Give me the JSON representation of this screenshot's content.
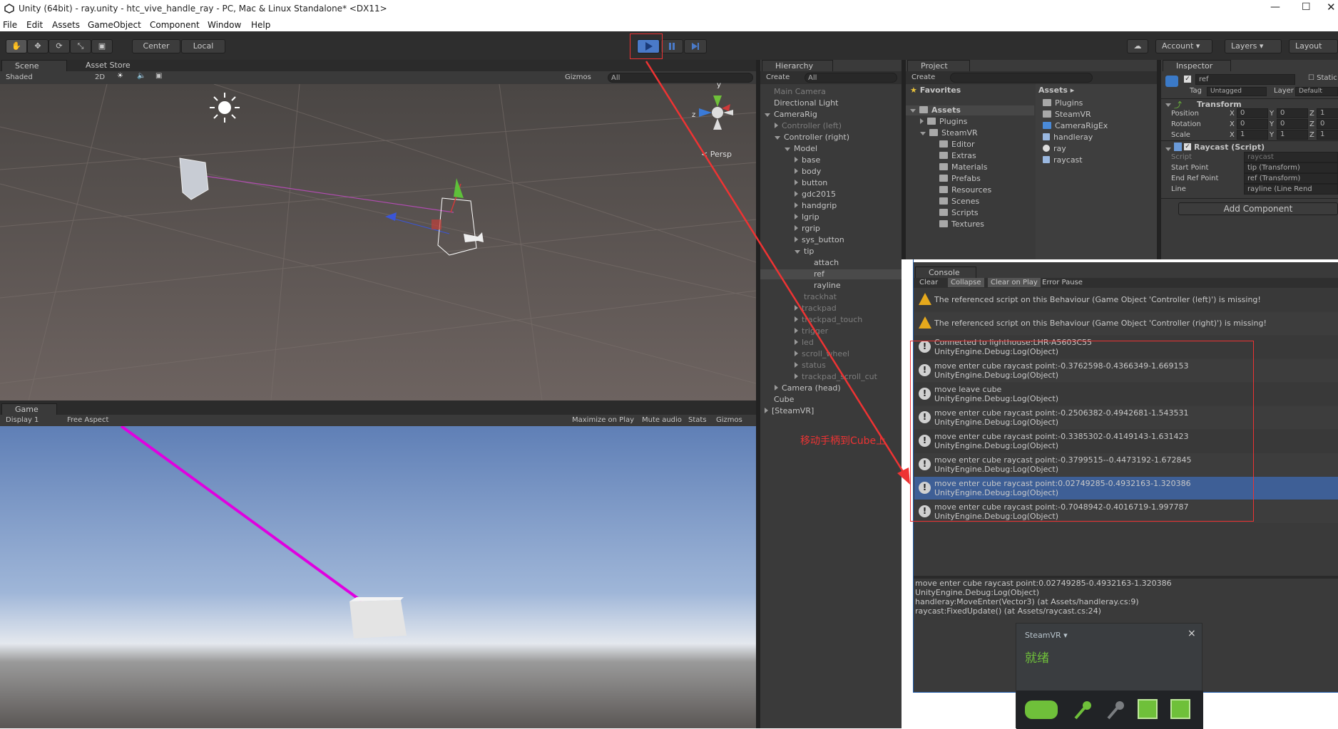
{
  "window": {
    "title": "Unity (64bit) - ray.unity - htc_vive_handle_ray - PC, Mac & Linux Standalone* <DX11>"
  },
  "menu": [
    "File",
    "Edit",
    "Assets",
    "GameObject",
    "Component",
    "Window",
    "Help"
  ],
  "toolbar": {
    "center": "Center",
    "local": "Local",
    "account": "Account",
    "layers": "Layers",
    "layout": "Layout"
  },
  "scene": {
    "tab": "Scene",
    "asset_store": "Asset Store",
    "shading": "Shaded",
    "mode_2d": "2D",
    "gizmos": "Gizmos",
    "search": "All",
    "persp": "< Persp",
    "gizmo_y": "y",
    "gizmo_z": "z"
  },
  "game": {
    "tab": "Game",
    "display": "Display 1",
    "aspect": "Free Aspect",
    "maximize": "Maximize on Play",
    "mute": "Mute audio",
    "stats": "Stats",
    "gizmos": "Gizmos"
  },
  "hierarchy": {
    "tab": "Hierarchy",
    "create": "Create",
    "search": "All",
    "items": [
      {
        "label": "Main Camera",
        "indent": 0,
        "dim": true,
        "arrow": ""
      },
      {
        "label": "Directional Light",
        "indent": 0,
        "dim": false,
        "arrow": ""
      },
      {
        "label": "CameraRig",
        "indent": 0,
        "dim": false,
        "arrow": "down"
      },
      {
        "label": "Controller (left)",
        "indent": 1,
        "dim": true,
        "arrow": "right"
      },
      {
        "label": "Controller (right)",
        "indent": 1,
        "dim": false,
        "arrow": "down"
      },
      {
        "label": "Model",
        "indent": 2,
        "dim": false,
        "arrow": "down"
      },
      {
        "label": "base",
        "indent": 3,
        "dim": false,
        "arrow": "right"
      },
      {
        "label": "body",
        "indent": 3,
        "dim": false,
        "arrow": "right"
      },
      {
        "label": "button",
        "indent": 3,
        "dim": false,
        "arrow": "right"
      },
      {
        "label": "gdc2015",
        "indent": 3,
        "dim": false,
        "arrow": "right"
      },
      {
        "label": "handgrip",
        "indent": 3,
        "dim": false,
        "arrow": "right"
      },
      {
        "label": "lgrip",
        "indent": 3,
        "dim": false,
        "arrow": "right"
      },
      {
        "label": "rgrip",
        "indent": 3,
        "dim": false,
        "arrow": "right"
      },
      {
        "label": "sys_button",
        "indent": 3,
        "dim": false,
        "arrow": "right"
      },
      {
        "label": "tip",
        "indent": 3,
        "dim": false,
        "arrow": "down"
      },
      {
        "label": "attach",
        "indent": 4,
        "dim": false,
        "arrow": ""
      },
      {
        "label": "ref",
        "indent": 4,
        "dim": false,
        "arrow": "",
        "selected": true
      },
      {
        "label": "rayline",
        "indent": 4,
        "dim": false,
        "arrow": ""
      },
      {
        "label": "trackhat",
        "indent": 3,
        "dim": true,
        "arrow": ""
      },
      {
        "label": "trackpad",
        "indent": 3,
        "dim": true,
        "arrow": "right"
      },
      {
        "label": "trackpad_touch",
        "indent": 3,
        "dim": true,
        "arrow": "right"
      },
      {
        "label": "trigger",
        "indent": 3,
        "dim": true,
        "arrow": "right"
      },
      {
        "label": "led",
        "indent": 3,
        "dim": true,
        "arrow": "right"
      },
      {
        "label": "scroll_wheel",
        "indent": 3,
        "dim": true,
        "arrow": "right"
      },
      {
        "label": "status",
        "indent": 3,
        "dim": true,
        "arrow": "right"
      },
      {
        "label": "trackpad_scroll_cut",
        "indent": 3,
        "dim": true,
        "arrow": "right"
      },
      {
        "label": "Camera (head)",
        "indent": 1,
        "dim": false,
        "arrow": "right"
      },
      {
        "label": "Cube",
        "indent": 0,
        "dim": false,
        "arrow": ""
      },
      {
        "label": "[SteamVR]",
        "indent": 0,
        "dim": false,
        "arrow": "right"
      }
    ]
  },
  "annotation": "移动手柄到Cube上",
  "project": {
    "tab": "Project",
    "create": "Create",
    "favorites": "Favorites",
    "assets_root": "Assets",
    "tree": [
      {
        "label": "Plugins",
        "indent": 1
      },
      {
        "label": "SteamVR",
        "indent": 1,
        "open": true
      },
      {
        "label": "Editor",
        "indent": 2
      },
      {
        "label": "Extras",
        "indent": 2
      },
      {
        "label": "Materials",
        "indent": 2
      },
      {
        "label": "Prefabs",
        "indent": 2
      },
      {
        "label": "Resources",
        "indent": 2
      },
      {
        "label": "Scenes",
        "indent": 2
      },
      {
        "label": "Scripts",
        "indent": 2
      },
      {
        "label": "Textures",
        "indent": 2
      }
    ],
    "assets_header": "Assets ▸",
    "assets": [
      {
        "label": "Plugins",
        "icon": "folder-icon"
      },
      {
        "label": "SteamVR",
        "icon": "folder-icon"
      },
      {
        "label": "CameraRigEx",
        "icon": "prefab-icon"
      },
      {
        "label": "handleray",
        "icon": "script-icon"
      },
      {
        "label": "ray",
        "icon": "unity-scene-icon"
      },
      {
        "label": "raycast",
        "icon": "script-icon"
      }
    ]
  },
  "inspector": {
    "tab": "Inspector",
    "name": "ref",
    "static": "Static",
    "tag_label": "Tag",
    "tag": "Untagged",
    "layer_label": "Layer",
    "layer": "Default",
    "transform": {
      "title": "Transform",
      "position": {
        "label": "Position",
        "x": "0",
        "y": "0",
        "z": "1"
      },
      "rotation": {
        "label": "Rotation",
        "x": "0",
        "y": "0",
        "z": "0"
      },
      "scale": {
        "label": "Scale",
        "x": "1",
        "y": "1",
        "z": "1"
      }
    },
    "raycast": {
      "title": "Raycast (Script)",
      "script_label": "Script",
      "script": "raycast",
      "start_label": "Start Point",
      "start": "tip (Transform)",
      "end_label": "End Ref Point",
      "end": "ref (Transform)",
      "line_label": "Line",
      "line": "rayline (Line Rend"
    },
    "add_component": "Add Component"
  },
  "console": {
    "tab": "Console",
    "buttons": [
      "Clear",
      "Collapse",
      "Clear on Play",
      "Error Pause"
    ],
    "entries": [
      {
        "type": "warning",
        "line1": "The referenced script on this Behaviour (Game Object 'Controller (left)') is missing!",
        "line2": ""
      },
      {
        "type": "warning",
        "line1": "The referenced script on this Behaviour (Game Object 'Controller (right)') is missing!",
        "line2": ""
      },
      {
        "type": "info",
        "line1": "Connected to lighthouse:LHR-A5603C55",
        "line2": "UnityEngine.Debug:Log(Object)"
      },
      {
        "type": "info",
        "line1": "move enter cube raycast point:-0.3762598-0.4366349-1.669153",
        "line2": "UnityEngine.Debug:Log(Object)"
      },
      {
        "type": "info",
        "line1": "move leave cube",
        "line2": "UnityEngine.Debug:Log(Object)"
      },
      {
        "type": "info",
        "line1": "move enter cube raycast point:-0.2506382-0.4942681-1.543531",
        "line2": "UnityEngine.Debug:Log(Object)"
      },
      {
        "type": "info",
        "line1": "move enter cube raycast point:-0.3385302-0.4149143-1.631423",
        "line2": "UnityEngine.Debug:Log(Object)"
      },
      {
        "type": "info",
        "line1": "move enter cube raycast point:-0.3799515--0.4473192-1.672845",
        "line2": "UnityEngine.Debug:Log(Object)"
      },
      {
        "type": "info",
        "line1": "move enter cube raycast point:0.02749285-0.4932163-1.320386",
        "line2": "UnityEngine.Debug:Log(Object)",
        "selected": true
      },
      {
        "type": "info",
        "line1": "move enter cube raycast point:-0.7048942-0.4016719-1.997787",
        "line2": "UnityEngine.Debug:Log(Object)"
      }
    ],
    "detail": [
      "move enter cube raycast point:0.02749285-0.4932163-1.320386",
      "UnityEngine.Debug:Log(Object)",
      "handleray:MoveEnter(Vector3) (at Assets/handleray.cs:9)",
      "raycast:FixedUpdate() (at Assets/raycast.cs:24)"
    ]
  },
  "steamvr": {
    "title": "SteamVR ▾",
    "status": "就绪",
    "close": "×"
  }
}
